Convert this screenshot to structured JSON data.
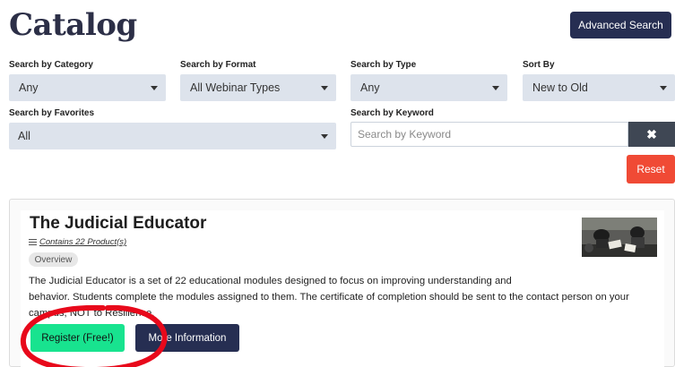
{
  "header": {
    "title": "Catalog",
    "advanced_search_label": "Advanced Search"
  },
  "filters": {
    "category": {
      "label": "Search by Category",
      "value": "Any"
    },
    "format": {
      "label": "Search by Format",
      "value": "All Webinar Types"
    },
    "type": {
      "label": "Search by Type",
      "value": "Any"
    },
    "sort": {
      "label": "Sort By",
      "value": "New to Old"
    },
    "favorites": {
      "label": "Search by Favorites",
      "value": "All"
    },
    "keyword": {
      "label": "Search by Keyword",
      "placeholder": "Search by Keyword",
      "clear_icon": "✖"
    },
    "reset_label": "Reset"
  },
  "product": {
    "title": "The Judicial Educator",
    "contains": "Contains 22 Product(s)",
    "overview_tag": "Overview",
    "description_1": "The Judicial Educator is a set of 22 educational modules designed to focus on improving understanding and",
    "description_2": "behavior. Students complete the modules assigned to them. The certificate of completion should be sent to the contact person on your",
    "description_3": "campus, NOT to Resilience.",
    "register_label": "Register (Free!)",
    "more_info_label": "More Information"
  },
  "colors": {
    "primary_navy": "#262e52",
    "register_green": "#18e38f",
    "reset_red": "#f04a35",
    "select_bg": "#dde3ec",
    "annotation_red": "#e8091b"
  },
  "icons": {
    "dropdown": "chevron-down-icon",
    "list": "list-icon",
    "clear": "close-icon"
  }
}
